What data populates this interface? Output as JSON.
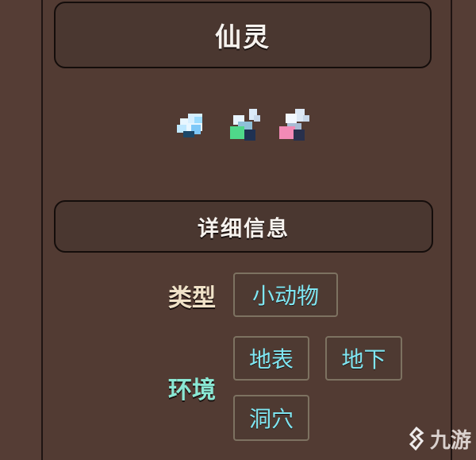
{
  "header": {
    "title": "仙灵"
  },
  "sprites": [
    {
      "name": "fairy-blue",
      "color": "#a8dcf8"
    },
    {
      "name": "fairy-green",
      "color": "#5ee08e"
    },
    {
      "name": "fairy-pink",
      "color": "#f08ab8"
    }
  ],
  "details": {
    "heading": "详细信息",
    "type_label": "类型",
    "type_values": [
      "小动物"
    ],
    "environment_label": "环境",
    "environment_values": [
      "地表",
      "地下",
      "洞穴"
    ]
  },
  "watermark": {
    "text": "九游"
  },
  "colors": {
    "panel_background": "#523b33",
    "border": "#140d0b",
    "tag_text": "#7fe6f2",
    "environment_label": "#8ae8d4",
    "type_label": "#f0e2c8"
  }
}
